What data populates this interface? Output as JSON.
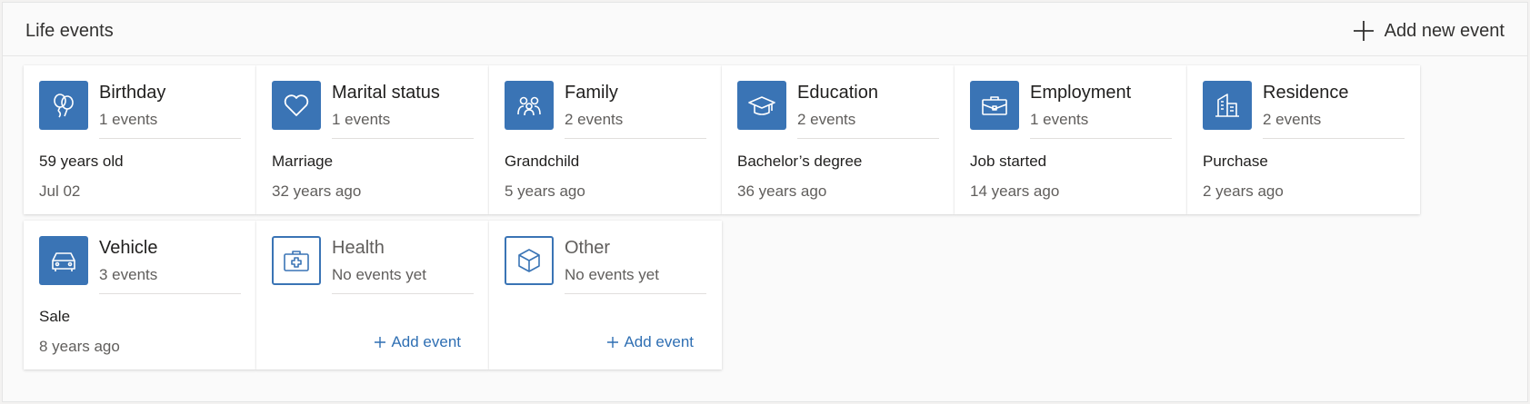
{
  "header": {
    "title": "Life events",
    "add_new_label": "Add new event"
  },
  "cards": [
    {
      "title": "Birthday",
      "subtitle": "1 events",
      "event": "59 years old",
      "time": "Jul 02",
      "icon": "balloons-icon"
    },
    {
      "title": "Marital status",
      "subtitle": "1 events",
      "event": "Marriage",
      "time": "32 years ago",
      "icon": "heart-icon"
    },
    {
      "title": "Family",
      "subtitle": "2 events",
      "event": "Grandchild",
      "time": "5 years ago",
      "icon": "family-icon"
    },
    {
      "title": "Education",
      "subtitle": "2 events",
      "event": "Bachelor’s degree",
      "time": "36 years ago",
      "icon": "graduation-cap-icon"
    },
    {
      "title": "Employment",
      "subtitle": "1 events",
      "event": "Job started",
      "time": "14 years ago",
      "icon": "briefcase-icon"
    },
    {
      "title": "Residence",
      "subtitle": "2 events",
      "event": "Purchase",
      "time": "2 years ago",
      "icon": "building-icon"
    },
    {
      "title": "Vehicle",
      "subtitle": "3 events",
      "event": "Sale",
      "time": "8 years ago",
      "icon": "car-icon"
    },
    {
      "title": "Health",
      "subtitle": "No events yet",
      "add_label": "Add event",
      "icon": "medical-kit-icon"
    },
    {
      "title": "Other",
      "subtitle": "No events yet",
      "add_label": "Add event",
      "icon": "cube-icon"
    }
  ],
  "colors": {
    "accent": "#3a74b5",
    "link": "#2f6fb3"
  }
}
